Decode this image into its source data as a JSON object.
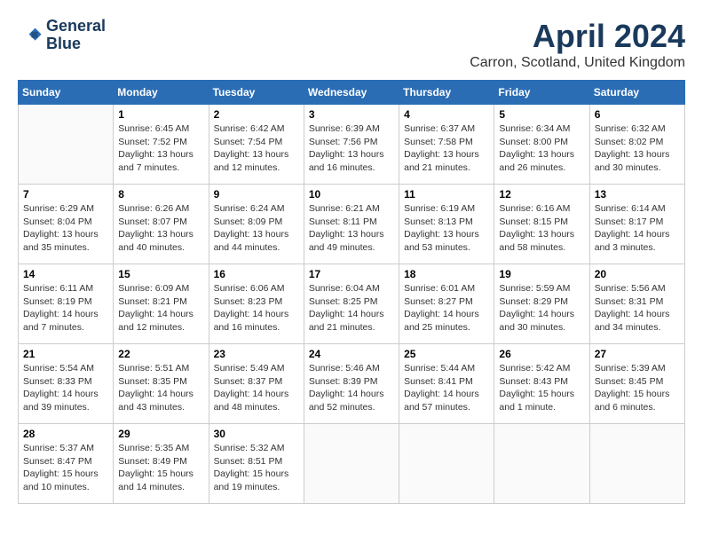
{
  "logo": {
    "line1": "General",
    "line2": "Blue"
  },
  "title": "April 2024",
  "location": "Carron, Scotland, United Kingdom",
  "headers": [
    "Sunday",
    "Monday",
    "Tuesday",
    "Wednesday",
    "Thursday",
    "Friday",
    "Saturday"
  ],
  "weeks": [
    [
      {
        "day": "",
        "info": ""
      },
      {
        "day": "1",
        "info": "Sunrise: 6:45 AM\nSunset: 7:52 PM\nDaylight: 13 hours\nand 7 minutes."
      },
      {
        "day": "2",
        "info": "Sunrise: 6:42 AM\nSunset: 7:54 PM\nDaylight: 13 hours\nand 12 minutes."
      },
      {
        "day": "3",
        "info": "Sunrise: 6:39 AM\nSunset: 7:56 PM\nDaylight: 13 hours\nand 16 minutes."
      },
      {
        "day": "4",
        "info": "Sunrise: 6:37 AM\nSunset: 7:58 PM\nDaylight: 13 hours\nand 21 minutes."
      },
      {
        "day": "5",
        "info": "Sunrise: 6:34 AM\nSunset: 8:00 PM\nDaylight: 13 hours\nand 26 minutes."
      },
      {
        "day": "6",
        "info": "Sunrise: 6:32 AM\nSunset: 8:02 PM\nDaylight: 13 hours\nand 30 minutes."
      }
    ],
    [
      {
        "day": "7",
        "info": "Sunrise: 6:29 AM\nSunset: 8:04 PM\nDaylight: 13 hours\nand 35 minutes."
      },
      {
        "day": "8",
        "info": "Sunrise: 6:26 AM\nSunset: 8:07 PM\nDaylight: 13 hours\nand 40 minutes."
      },
      {
        "day": "9",
        "info": "Sunrise: 6:24 AM\nSunset: 8:09 PM\nDaylight: 13 hours\nand 44 minutes."
      },
      {
        "day": "10",
        "info": "Sunrise: 6:21 AM\nSunset: 8:11 PM\nDaylight: 13 hours\nand 49 minutes."
      },
      {
        "day": "11",
        "info": "Sunrise: 6:19 AM\nSunset: 8:13 PM\nDaylight: 13 hours\nand 53 minutes."
      },
      {
        "day": "12",
        "info": "Sunrise: 6:16 AM\nSunset: 8:15 PM\nDaylight: 13 hours\nand 58 minutes."
      },
      {
        "day": "13",
        "info": "Sunrise: 6:14 AM\nSunset: 8:17 PM\nDaylight: 14 hours\nand 3 minutes."
      }
    ],
    [
      {
        "day": "14",
        "info": "Sunrise: 6:11 AM\nSunset: 8:19 PM\nDaylight: 14 hours\nand 7 minutes."
      },
      {
        "day": "15",
        "info": "Sunrise: 6:09 AM\nSunset: 8:21 PM\nDaylight: 14 hours\nand 12 minutes."
      },
      {
        "day": "16",
        "info": "Sunrise: 6:06 AM\nSunset: 8:23 PM\nDaylight: 14 hours\nand 16 minutes."
      },
      {
        "day": "17",
        "info": "Sunrise: 6:04 AM\nSunset: 8:25 PM\nDaylight: 14 hours\nand 21 minutes."
      },
      {
        "day": "18",
        "info": "Sunrise: 6:01 AM\nSunset: 8:27 PM\nDaylight: 14 hours\nand 25 minutes."
      },
      {
        "day": "19",
        "info": "Sunrise: 5:59 AM\nSunset: 8:29 PM\nDaylight: 14 hours\nand 30 minutes."
      },
      {
        "day": "20",
        "info": "Sunrise: 5:56 AM\nSunset: 8:31 PM\nDaylight: 14 hours\nand 34 minutes."
      }
    ],
    [
      {
        "day": "21",
        "info": "Sunrise: 5:54 AM\nSunset: 8:33 PM\nDaylight: 14 hours\nand 39 minutes."
      },
      {
        "day": "22",
        "info": "Sunrise: 5:51 AM\nSunset: 8:35 PM\nDaylight: 14 hours\nand 43 minutes."
      },
      {
        "day": "23",
        "info": "Sunrise: 5:49 AM\nSunset: 8:37 PM\nDaylight: 14 hours\nand 48 minutes."
      },
      {
        "day": "24",
        "info": "Sunrise: 5:46 AM\nSunset: 8:39 PM\nDaylight: 14 hours\nand 52 minutes."
      },
      {
        "day": "25",
        "info": "Sunrise: 5:44 AM\nSunset: 8:41 PM\nDaylight: 14 hours\nand 57 minutes."
      },
      {
        "day": "26",
        "info": "Sunrise: 5:42 AM\nSunset: 8:43 PM\nDaylight: 15 hours\nand 1 minute."
      },
      {
        "day": "27",
        "info": "Sunrise: 5:39 AM\nSunset: 8:45 PM\nDaylight: 15 hours\nand 6 minutes."
      }
    ],
    [
      {
        "day": "28",
        "info": "Sunrise: 5:37 AM\nSunset: 8:47 PM\nDaylight: 15 hours\nand 10 minutes."
      },
      {
        "day": "29",
        "info": "Sunrise: 5:35 AM\nSunset: 8:49 PM\nDaylight: 15 hours\nand 14 minutes."
      },
      {
        "day": "30",
        "info": "Sunrise: 5:32 AM\nSunset: 8:51 PM\nDaylight: 15 hours\nand 19 minutes."
      },
      {
        "day": "",
        "info": ""
      },
      {
        "day": "",
        "info": ""
      },
      {
        "day": "",
        "info": ""
      },
      {
        "day": "",
        "info": ""
      }
    ]
  ]
}
